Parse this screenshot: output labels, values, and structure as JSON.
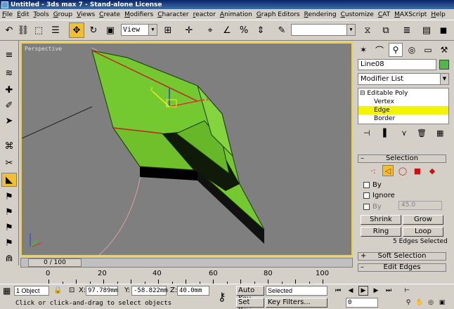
{
  "window": {
    "title": "Untitled - 3ds max 7 - Stand-alone License"
  },
  "menu": [
    "File",
    "Edit",
    "Tools",
    "Group",
    "Views",
    "Create",
    "Modifiers",
    "Character",
    "reactor",
    "Animation",
    "Graph Editors",
    "Rendering",
    "Customize",
    "CAT",
    "MAXScript",
    "Help"
  ],
  "toolbar": {
    "ref_coord": "View",
    "named_sel": ""
  },
  "viewport": {
    "label": "Perspective"
  },
  "timeline": {
    "slider": "0 / 100",
    "ticks": [
      "0",
      "20",
      "40",
      "60",
      "80",
      "100"
    ]
  },
  "command_panel": {
    "object_name": "Line08",
    "object_color": "#52b84a",
    "modifier_list": "Modifier List",
    "stack": [
      "Editable Poly",
      "Vertex",
      "Edge",
      "Border"
    ],
    "selected_stack_item": "Edge"
  },
  "selection": {
    "header": "Selection",
    "by_label": "By",
    "ignore_label": "Ignore",
    "by_angle_label": "By",
    "angle_value": "45.0",
    "shrink": "Shrink",
    "grow": "Grow",
    "ring": "Ring",
    "loop": "Loop",
    "status": "5 Edges Selected"
  },
  "rollouts": {
    "soft_selection": "Soft Selection",
    "edit_edges": "Edit Edges"
  },
  "status": {
    "objects": "1 Object",
    "x_label": "X:",
    "x": "97.789mm",
    "y_label": "Y:",
    "y": "-58.822mm",
    "z_label": "Z:",
    "z": "40.0mm",
    "auto_key": "Auto Key",
    "key_mode": "Selected",
    "set_key": "Set Key",
    "key_filters": "Key Filters...",
    "prompt": "Click or click-and-drag to select objects",
    "frame": "0"
  }
}
